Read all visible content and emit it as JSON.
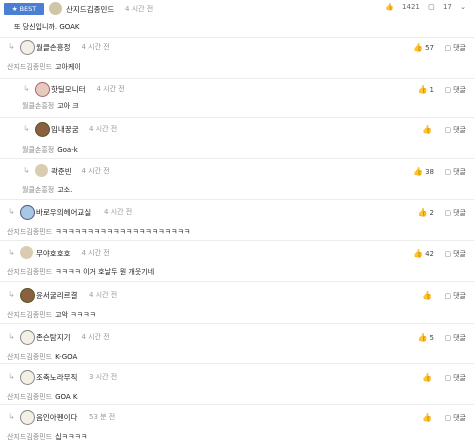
{
  "best": {
    "badge": "★ BEST",
    "author": "산지드김종민드",
    "time": "4 시간 전",
    "likes": "1421",
    "comments": "17",
    "text": "또 당신입니까. GOAK"
  },
  "reply_label": "댓글",
  "comments": [
    {
      "author": "월클손흥정",
      "time": "4 시간 전",
      "mention": "산지드김종민드",
      "text": "고아케이",
      "likes": "57",
      "avatar": "dog"
    },
    {
      "author": "핫딜모니터",
      "time": "4 시간 전",
      "mention": "월클손흥정",
      "text": "고아 크",
      "likes": "1",
      "avatar": "red"
    },
    {
      "author": "임내꿍굼",
      "time": "4 시간 전",
      "mention": "월클손흥정",
      "text": "Goa-k",
      "likes": "",
      "avatar": "dog2"
    },
    {
      "author": "곽준빈",
      "time": "4 시간 전",
      "mention": "월클손흥정",
      "text": "고소.",
      "likes": "38",
      "avatar": "circle"
    },
    {
      "author": "바로우의헤어교실",
      "time": "4 시간 전",
      "mention": "산지드김종민드",
      "text": "ㅋㅋㅋㅋㅋㅋㅋㅋㅋㅋㅋㅋㅋㅋㅋㅋㅋㅋㅋㅋㅋ",
      "likes": "2",
      "avatar": "blue"
    },
    {
      "author": "무야호호호",
      "time": "4 시간 전",
      "mention": "산지드김종민드",
      "text": "ㅋㅋㅋㅋ 이거 호날두 뭔 개웃기네",
      "likes": "42",
      "avatar": "circle"
    },
    {
      "author": "윤서굴리르결",
      "time": "4 시간 전",
      "mention": "산지드김종민드",
      "text": "고악 ㅋㅋㅋㅋ",
      "likes": "",
      "avatar": "dog2"
    },
    {
      "author": "존슨탐지기",
      "time": "4 시간 전",
      "mention": "산지드김종민드",
      "text": "K-GOA",
      "likes": "5",
      "avatar": "dog"
    },
    {
      "author": "조축노라무직",
      "time": "3 시간 전",
      "mention": "산지드김종민드",
      "text": "GOA K",
      "likes": "",
      "avatar": "dog"
    },
    {
      "author": "음인아펜이다",
      "time": "53 분 전",
      "mention": "산지드김종민드",
      "text": "십ㅋㅋㅋㅋ",
      "likes": "",
      "avatar": "dog"
    }
  ]
}
